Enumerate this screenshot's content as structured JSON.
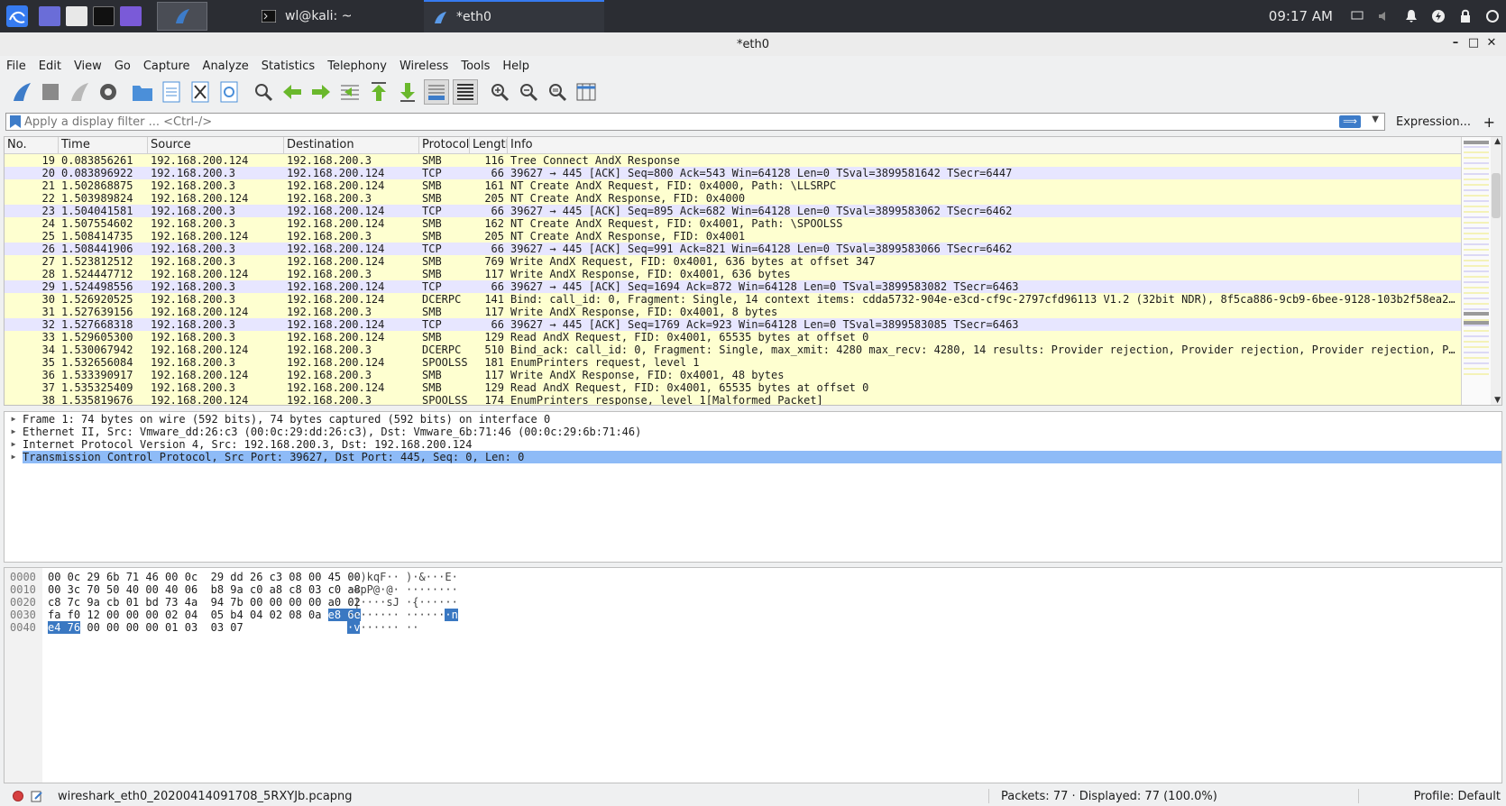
{
  "taskbar": {
    "tasks": [
      {
        "label": "wl@kali: ~",
        "icon": "terminal-icon"
      },
      {
        "label": "*eth0",
        "icon": "wireshark-fin-icon"
      }
    ],
    "clock": "09:17 AM"
  },
  "window": {
    "title": "*eth0"
  },
  "menu": [
    "File",
    "Edit",
    "View",
    "Go",
    "Capture",
    "Analyze",
    "Statistics",
    "Telephony",
    "Wireless",
    "Tools",
    "Help"
  ],
  "filter": {
    "placeholder": "Apply a display filter ... <Ctrl-/>",
    "apply": "⟹",
    "expression": "Expression...",
    "plus": "+"
  },
  "packet_list": {
    "columns": [
      "No.",
      "Time",
      "Source",
      "Destination",
      "Protocol",
      "Length",
      "Info"
    ],
    "rows": [
      [
        "19",
        "0.083856261",
        "192.168.200.124",
        "192.168.200.3",
        "SMB",
        "116",
        "Tree Connect AndX Response"
      ],
      [
        "20",
        "0.083896922",
        "192.168.200.3",
        "192.168.200.124",
        "TCP",
        "66",
        "39627 → 445 [ACK] Seq=800 Ack=543 Win=64128 Len=0 TSval=3899581642 TSecr=6447"
      ],
      [
        "21",
        "1.502868875",
        "192.168.200.3",
        "192.168.200.124",
        "SMB",
        "161",
        "NT Create AndX Request, FID: 0x4000, Path: \\LLSRPC"
      ],
      [
        "22",
        "1.503989824",
        "192.168.200.124",
        "192.168.200.3",
        "SMB",
        "205",
        "NT Create AndX Response, FID: 0x4000"
      ],
      [
        "23",
        "1.504041581",
        "192.168.200.3",
        "192.168.200.124",
        "TCP",
        "66",
        "39627 → 445 [ACK] Seq=895 Ack=682 Win=64128 Len=0 TSval=3899583062 TSecr=6462"
      ],
      [
        "24",
        "1.507554602",
        "192.168.200.3",
        "192.168.200.124",
        "SMB",
        "162",
        "NT Create AndX Request, FID: 0x4001, Path: \\SPOOLSS"
      ],
      [
        "25",
        "1.508414735",
        "192.168.200.124",
        "192.168.200.3",
        "SMB",
        "205",
        "NT Create AndX Response, FID: 0x4001"
      ],
      [
        "26",
        "1.508441906",
        "192.168.200.3",
        "192.168.200.124",
        "TCP",
        "66",
        "39627 → 445 [ACK] Seq=991 Ack=821 Win=64128 Len=0 TSval=3899583066 TSecr=6462"
      ],
      [
        "27",
        "1.523812512",
        "192.168.200.3",
        "192.168.200.124",
        "SMB",
        "769",
        "Write AndX Request, FID: 0x4001, 636 bytes at offset 347"
      ],
      [
        "28",
        "1.524447712",
        "192.168.200.124",
        "192.168.200.3",
        "SMB",
        "117",
        "Write AndX Response, FID: 0x4001, 636 bytes"
      ],
      [
        "29",
        "1.524498556",
        "192.168.200.3",
        "192.168.200.124",
        "TCP",
        "66",
        "39627 → 445 [ACK] Seq=1694 Ack=872 Win=64128 Len=0 TSval=3899583082 TSecr=6463"
      ],
      [
        "30",
        "1.526920525",
        "192.168.200.3",
        "192.168.200.124",
        "DCERPC",
        "141",
        "Bind: call_id: 0, Fragment: Single, 14 context items: cdda5732-904e-e3cd-cf9c-2797cfd96113 V1.2 (32bit NDR), 8f5ca886-9cb9-6bee-9128-103b2f58ea2…"
      ],
      [
        "31",
        "1.527639156",
        "192.168.200.124",
        "192.168.200.3",
        "SMB",
        "117",
        "Write AndX Response, FID: 0x4001, 8 bytes"
      ],
      [
        "32",
        "1.527668318",
        "192.168.200.3",
        "192.168.200.124",
        "TCP",
        "66",
        "39627 → 445 [ACK] Seq=1769 Ack=923 Win=64128 Len=0 TSval=3899583085 TSecr=6463"
      ],
      [
        "33",
        "1.529605300",
        "192.168.200.3",
        "192.168.200.124",
        "SMB",
        "129",
        "Read AndX Request, FID: 0x4001, 65535 bytes at offset 0"
      ],
      [
        "34",
        "1.530067942",
        "192.168.200.124",
        "192.168.200.3",
        "DCERPC",
        "510",
        "Bind_ack: call_id: 0, Fragment: Single, max_xmit: 4280 max_recv: 4280, 14 results: Provider rejection, Provider rejection, Provider rejection, P…"
      ],
      [
        "35",
        "1.532656084",
        "192.168.200.3",
        "192.168.200.124",
        "SPOOLSS",
        "181",
        "EnumPrinters request, level 1"
      ],
      [
        "36",
        "1.533390917",
        "192.168.200.124",
        "192.168.200.3",
        "SMB",
        "117",
        "Write AndX Response, FID: 0x4001, 48 bytes"
      ],
      [
        "37",
        "1.535325409",
        "192.168.200.3",
        "192.168.200.124",
        "SMB",
        "129",
        "Read AndX Request, FID: 0x4001, 65535 bytes at offset 0"
      ],
      [
        "38",
        "1.535819676",
        "192.168.200.124",
        "192.168.200.3",
        "SPOOLSS",
        "174",
        "EnumPrinters response, level 1[Malformed Packet]"
      ]
    ]
  },
  "details": [
    "Frame 1: 74 bytes on wire (592 bits), 74 bytes captured (592 bits) on interface 0",
    "Ethernet II, Src: Vmware_dd:26:c3 (00:0c:29:dd:26:c3), Dst: Vmware_6b:71:46 (00:0c:29:6b:71:46)",
    "Internet Protocol Version 4, Src: 192.168.200.3, Dst: 192.168.200.124",
    "Transmission Control Protocol, Src Port: 39627, Dst Port: 445, Seq: 0, Len: 0"
  ],
  "hex": [
    {
      "off": "0000",
      "pre": "00 0c 29 6b 71 46 00 0c  29 dd 26 c3 08 00 45 00",
      "hl": "",
      "post": "",
      "apre": "··)kqF·· )·&···E·",
      "ahl": "",
      "apost": ""
    },
    {
      "off": "0010",
      "pre": "00 3c 70 50 40 00 40 06  b8 9a c0 a8 c8 03 c0 a8",
      "hl": "",
      "post": "",
      "apre": "·<pP@·@· ········",
      "ahl": "",
      "apost": ""
    },
    {
      "off": "0020",
      "pre": "c8 7c 9a cb 01 bd 73 4a  94 7b 00 00 00 00 a0 02",
      "hl": "",
      "post": "",
      "apre": "·|····sJ ·{······",
      "ahl": "",
      "apost": ""
    },
    {
      "off": "0030",
      "pre": "fa f0 12 00 00 00 02 04  05 b4 04 02 08 0a ",
      "hl": "e8 6e",
      "post": "",
      "apre": "········ ······",
      "ahl": "·n",
      "apost": ""
    },
    {
      "off": "0040",
      "pre": "",
      "hl": "e4 76",
      "post": " 00 00 00 00 01 03  03 07",
      "apre": "",
      "ahl": "·v",
      "apost": "······ ··"
    }
  ],
  "status": {
    "file": "wireshark_eth0_20200414091708_5RXYJb.pcapng",
    "packets": "Packets: 77 · Displayed: 77 (100.0%)",
    "profile": "Profile: Default"
  },
  "colors": {
    "smb": "#feffd0",
    "tcp": "#e7e6ff",
    "selected": "#8ebbf7",
    "accent": "#3d7cc9"
  }
}
